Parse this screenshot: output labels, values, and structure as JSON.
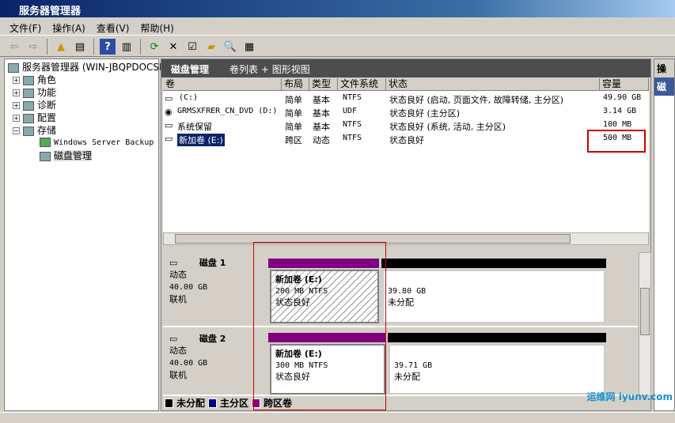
{
  "window": {
    "title": "服务器管理器"
  },
  "menu": [
    "文件(F)",
    "操作(A)",
    "查看(V)",
    "帮助(H)"
  ],
  "tree": {
    "root": "服务器管理器 (WIN-JBQPDOCSIS",
    "items": [
      {
        "label": "角色",
        "expander": "+"
      },
      {
        "label": "功能",
        "expander": "+"
      },
      {
        "label": "诊断",
        "expander": "+"
      },
      {
        "label": "配置",
        "expander": "+"
      },
      {
        "label": "存储",
        "expander": "−"
      }
    ],
    "children": [
      "Windows Server Backup",
      "磁盘管理"
    ]
  },
  "main": {
    "title": "磁盘管理",
    "view": "卷列表 + 图形视图"
  },
  "columns": [
    "卷",
    "布局",
    "类型",
    "文件系统",
    "状态",
    "容量"
  ],
  "volumes": [
    {
      "name": " (C:)",
      "layout": "简单",
      "type": "基本",
      "fs": "NTFS",
      "status": "状态良好 (启动, 页面文件, 故障转储, 主分区)",
      "capacity": "49.90 GB"
    },
    {
      "name": "GRMSXFRER_CN_DVD (D:)",
      "layout": "简单",
      "type": "基本",
      "fs": "UDF",
      "status": "状态良好 (主分区)",
      "capacity": "3.14 GB"
    },
    {
      "name": "系统保留",
      "layout": "简单",
      "type": "基本",
      "fs": "NTFS",
      "status": "状态良好 (系统, 活动, 主分区)",
      "capacity": "100 MB"
    },
    {
      "name": "新加卷 (E:)",
      "layout": "跨区",
      "type": "动态",
      "fs": "NTFS",
      "status": "状态良好",
      "capacity": "500 MB"
    }
  ],
  "disks": [
    {
      "name": "磁盘 1",
      "kind": "动态",
      "size": "40.00 GB",
      "state": "联机",
      "vol_name": "新加卷  (E:)",
      "vol_size": "200 MB NTFS",
      "vol_status": "状态良好",
      "free_size": "39.80 GB",
      "free_label": "未分配"
    },
    {
      "name": "磁盘 2",
      "kind": "动态",
      "size": "40.00 GB",
      "state": "联机",
      "vol_name": "新加卷  (E:)",
      "vol_size": "300 MB NTFS",
      "vol_status": "状态良好",
      "free_size": "39.71 GB",
      "free_label": "未分配"
    }
  ],
  "legend": [
    {
      "label": "未分配",
      "color": "#000000"
    },
    {
      "label": "主分区",
      "color": "#000080"
    },
    {
      "label": "跨区卷",
      "color": "#800080"
    }
  ],
  "action": {
    "title": "操",
    "item": "磁"
  },
  "watermark": "运维网 iyunv.com"
}
